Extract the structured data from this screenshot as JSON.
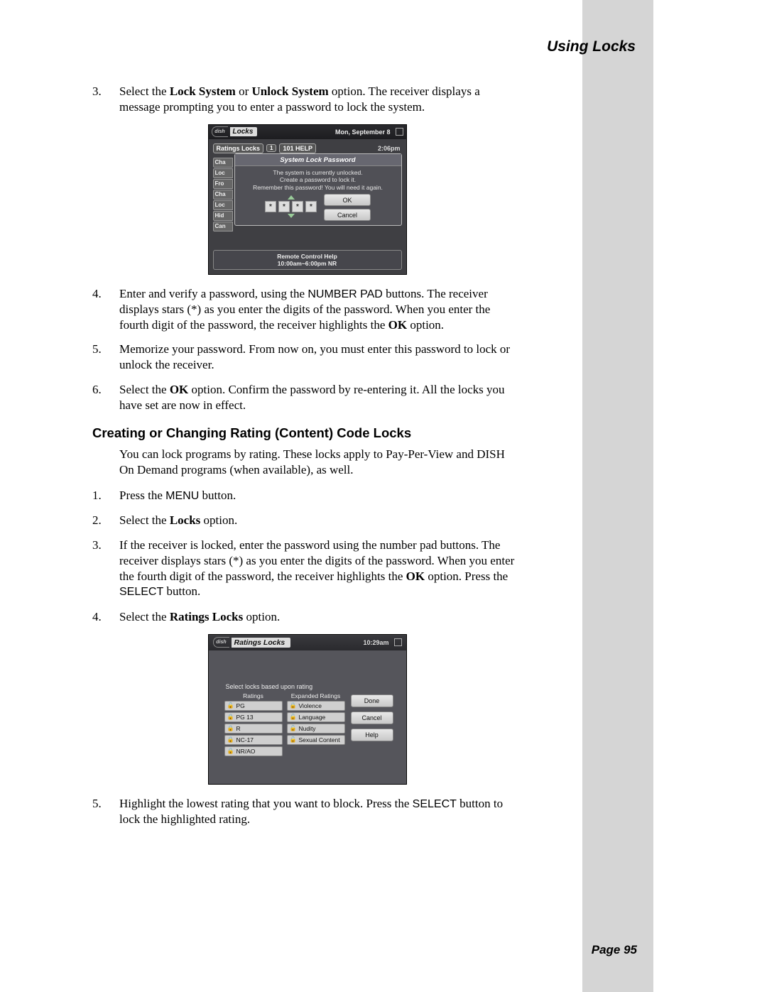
{
  "header": {
    "title": "Using Locks"
  },
  "footer": {
    "page": "Page 95"
  },
  "section1": {
    "step3": {
      "num": "3.",
      "pre": "Select the ",
      "b1": "Lock System",
      "mid": " or ",
      "b2": "Unlock System",
      "post": " option. The receiver displays a message prompting you to enter a password to lock the system."
    },
    "step4": {
      "num": "4.",
      "a": "Enter and verify a password, using the ",
      "btn": "NUMBER PAD",
      "b": " buttons. The receiver displays stars (*) as you enter the digits of the password. When you enter the fourth digit of the password, the receiver highlights the ",
      "ok": "OK",
      "c": " option."
    },
    "step5": {
      "num": "5.",
      "text": "Memorize your password. From now on, you must enter this password to lock or unlock the receiver."
    },
    "step6": {
      "num": "6.",
      "a": "Select the ",
      "ok": "OK",
      "b": " option. Confirm the password by re-entering it. All the locks you have set are now in effect."
    }
  },
  "heading": "Creating or Changing Rating (Content) Code Locks",
  "intro": "You can lock programs by rating. These locks apply to Pay-Per-View and DISH On Demand programs (when available), as well.",
  "section2": {
    "s1": {
      "num": "1.",
      "a": "Press the ",
      "btn": "MENU",
      "b": " button."
    },
    "s2": {
      "num": "2.",
      "a": "Select the ",
      "bold": "Locks",
      "b": " option."
    },
    "s3": {
      "num": "3.",
      "a": "If the receiver is locked, enter the password using the number pad buttons. The receiver displays stars (*) as you enter the digits of the password. When you enter the fourth digit of the password, the receiver highlights the ",
      "ok": "OK",
      "b": " option. Press the ",
      "btn": "SELECT",
      "c": " button."
    },
    "s4": {
      "num": "4.",
      "a": "Select the ",
      "bold": "Ratings Locks",
      "b": " option."
    },
    "s5": {
      "num": "5.",
      "a": "Highlight the lowest rating that you want to block. Press the ",
      "btn": "SELECT",
      "b": " button to lock the highlighted rating."
    }
  },
  "shot1": {
    "logo": "dish",
    "title": "Locks",
    "date": "Mon, September 8",
    "ratings_label": "Ratings Locks",
    "chnum": "1",
    "channel": "101 HELP",
    "time": "2:06pm",
    "tabs": [
      "Cha",
      "Loc",
      "Fro",
      "Cha",
      "Loc",
      "Hid",
      "Can"
    ],
    "dialog_title": "System Lock Password",
    "msg1": "The system is currently unlocked.",
    "msg2": "Create a password to lock it.",
    "msg3": "Remember this password! You will need it again.",
    "star": "*",
    "ok": "OK",
    "cancel": "Cancel",
    "footer1": "Remote Control Help",
    "footer2": "10:00am~6:00pm NR"
  },
  "shot2": {
    "logo": "dish",
    "title": "Ratings Locks",
    "time": "10:29am",
    "panel_head": "Select locks based upon rating",
    "col1": "Ratings",
    "col2": "Expanded Ratings",
    "ratings": [
      "PG",
      "PG 13",
      "R",
      "NC-17",
      "NR/AO"
    ],
    "expanded": [
      "Violence",
      "Language",
      "Nudity",
      "Sexual Content"
    ],
    "done": "Done",
    "cancel": "Cancel",
    "help": "Help",
    "lock_locked": "🔒",
    "lock_open": "🔓"
  }
}
